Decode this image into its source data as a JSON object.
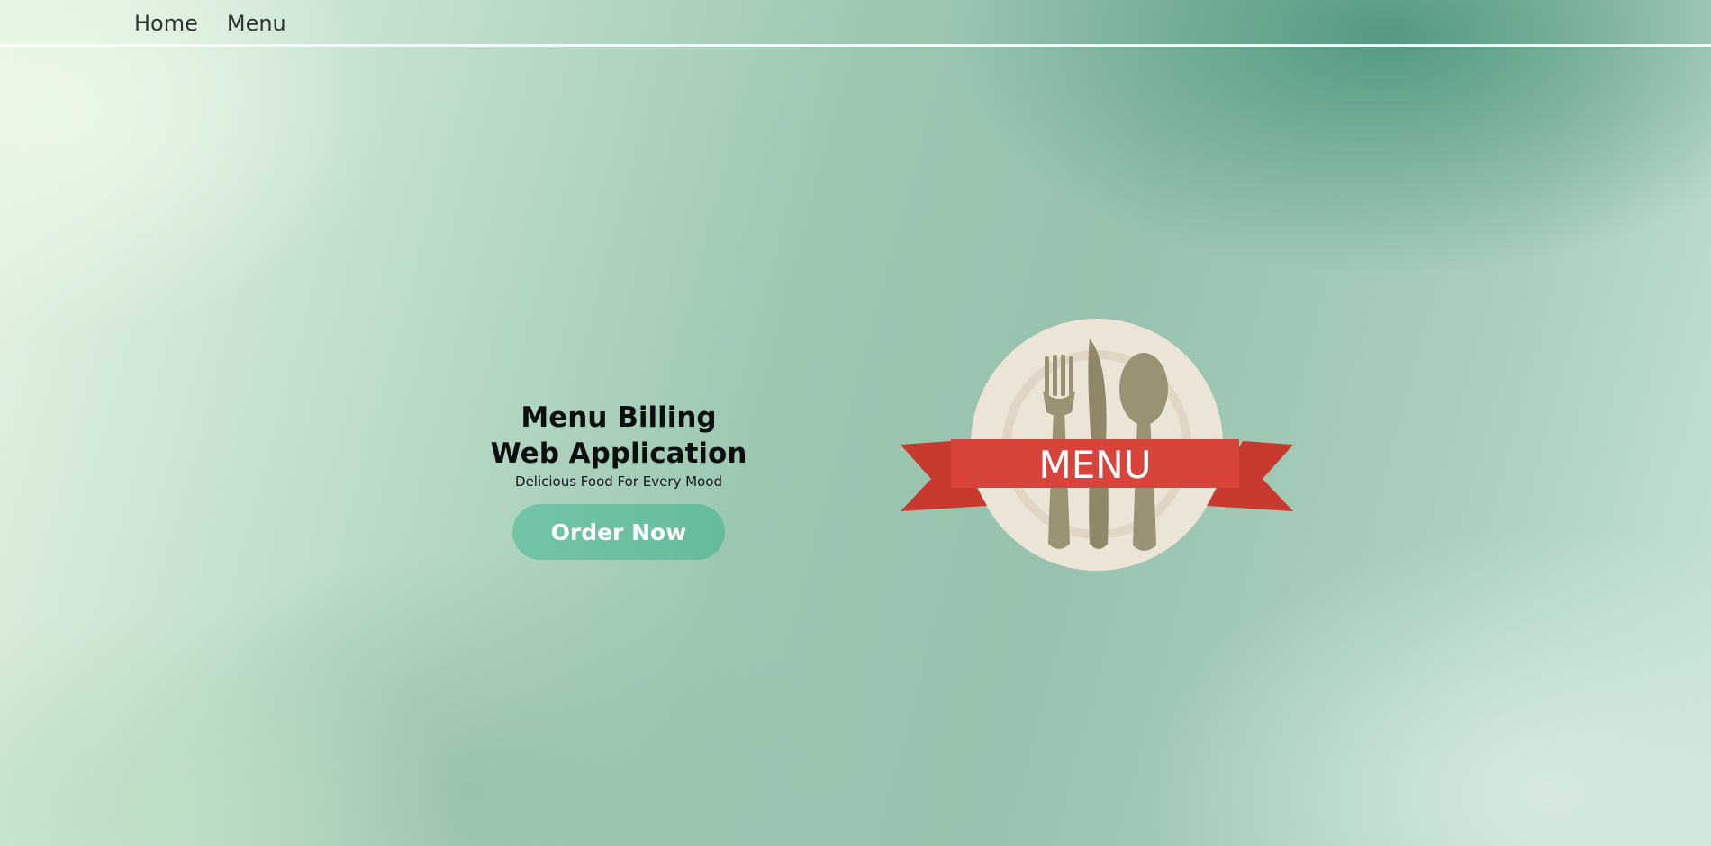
{
  "nav": {
    "items": [
      {
        "label": "Home"
      },
      {
        "label": "Menu"
      }
    ]
  },
  "hero": {
    "title": "Menu Billing Web Application",
    "subtitle": "Delicious Food For Every Mood",
    "cta_label": "Order Now"
  },
  "logo": {
    "banner_text": "MENU",
    "icon": "menu-plate-cutlery-icon"
  },
  "colors": {
    "accent": "#6cc1a1",
    "banner_red": "#d8443b",
    "plate": "#ede4d8",
    "cutlery": "#9a9273"
  }
}
